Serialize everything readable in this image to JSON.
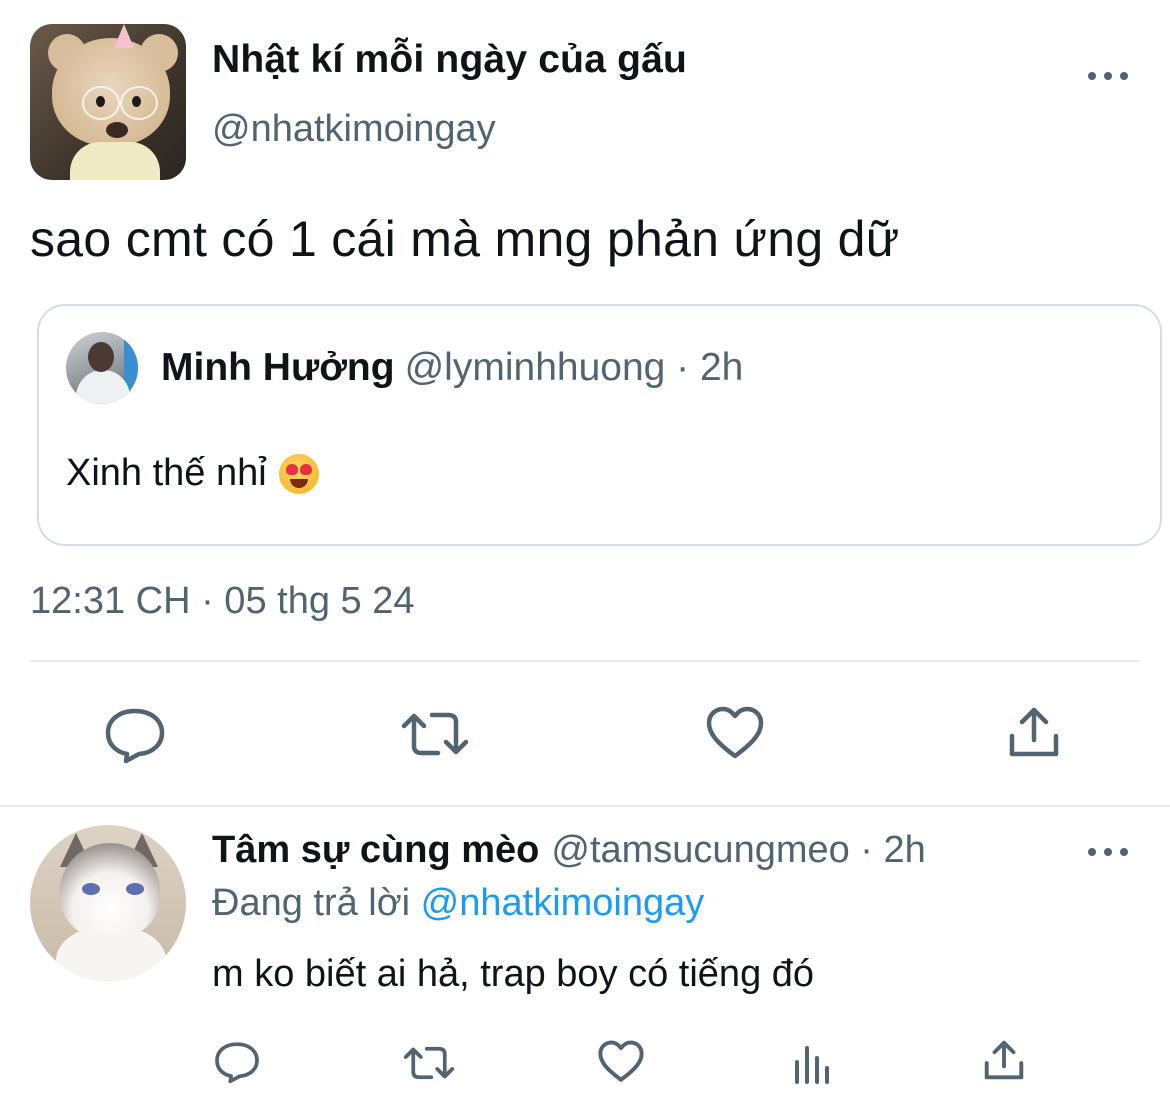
{
  "main_tweet": {
    "author_name": "Nhật kí mỗi ngày của gấu",
    "author_handle": "@nhatkimoingay",
    "text": "sao cmt có 1 cái mà mng phản ứng dữ",
    "quote": {
      "author_name": "Minh Hưởng",
      "meta": "@lyminhhuong · 2h",
      "text": "Xinh thế nhỉ"
    },
    "timestamp": "12:31 CH · 05 thg 5 24",
    "actions": [
      "reply-icon",
      "retweet-icon",
      "like-icon",
      "share-icon"
    ]
  },
  "reply_tweet": {
    "author_name": "Tâm sự cùng mèo",
    "meta": "@tamsucungmeo · 2h",
    "replying_prefix": "Đang trả lời",
    "replying_to": "@nhatkimoingay",
    "text": "m ko biết ai hả, trap boy có tiếng đó",
    "actions": [
      "reply-icon",
      "retweet-icon",
      "like-icon",
      "stats-icon",
      "share-icon"
    ]
  },
  "colors": {
    "text_primary": "#0f1419",
    "text_secondary": "#536471",
    "link": "#1d9bf0",
    "border": "#d7dde2"
  }
}
